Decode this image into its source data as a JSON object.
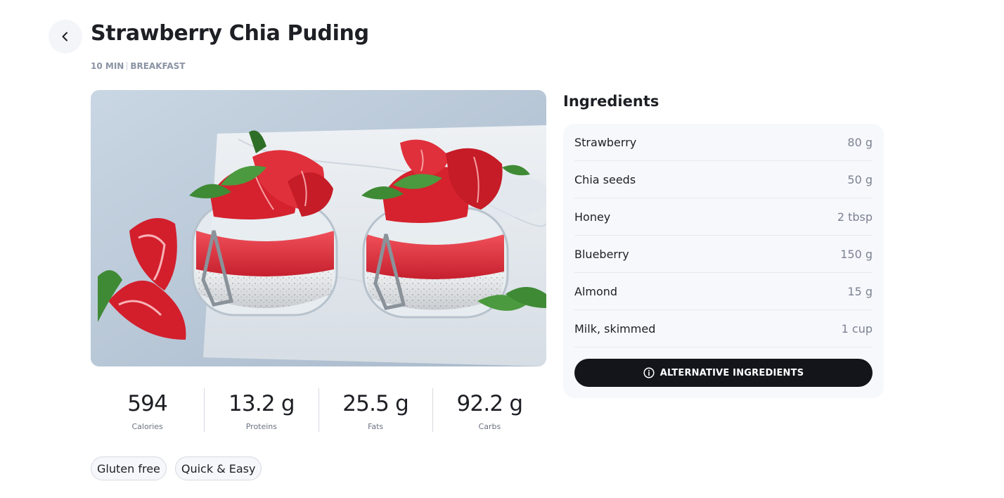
{
  "recipe": {
    "title": "Strawberry Chia Puding",
    "time": "10 MIN",
    "category": "BREAKFAST",
    "image_alt": "Strawberry chia pudding in glass jars"
  },
  "nutrition": [
    {
      "value": "594",
      "label": "Calories"
    },
    {
      "value": "13.2 g",
      "label": "Proteins"
    },
    {
      "value": "25.5 g",
      "label": "Fats"
    },
    {
      "value": "92.2 g",
      "label": "Carbs"
    }
  ],
  "tags": [
    "Gluten free",
    "Quick & Easy"
  ],
  "ingredients": {
    "heading": "Ingredients",
    "items": [
      {
        "name": "Strawberry",
        "qty": "80 g"
      },
      {
        "name": "Chia seeds",
        "qty": "50 g"
      },
      {
        "name": "Honey",
        "qty": "2 tbsp"
      },
      {
        "name": "Blueberry",
        "qty": "150 g"
      },
      {
        "name": "Almond",
        "qty": "15 g"
      },
      {
        "name": "Milk, skimmed",
        "qty": "1 cup"
      }
    ],
    "alt_button_label": "ALTERNATIVE INGREDIENTS"
  },
  "icons": {
    "back": "chevron-left-icon",
    "info": "info-icon"
  },
  "colors": {
    "button_dark": "#13151b",
    "card_bg": "#f7f8fc",
    "meta_text": "#8a93a4"
  }
}
